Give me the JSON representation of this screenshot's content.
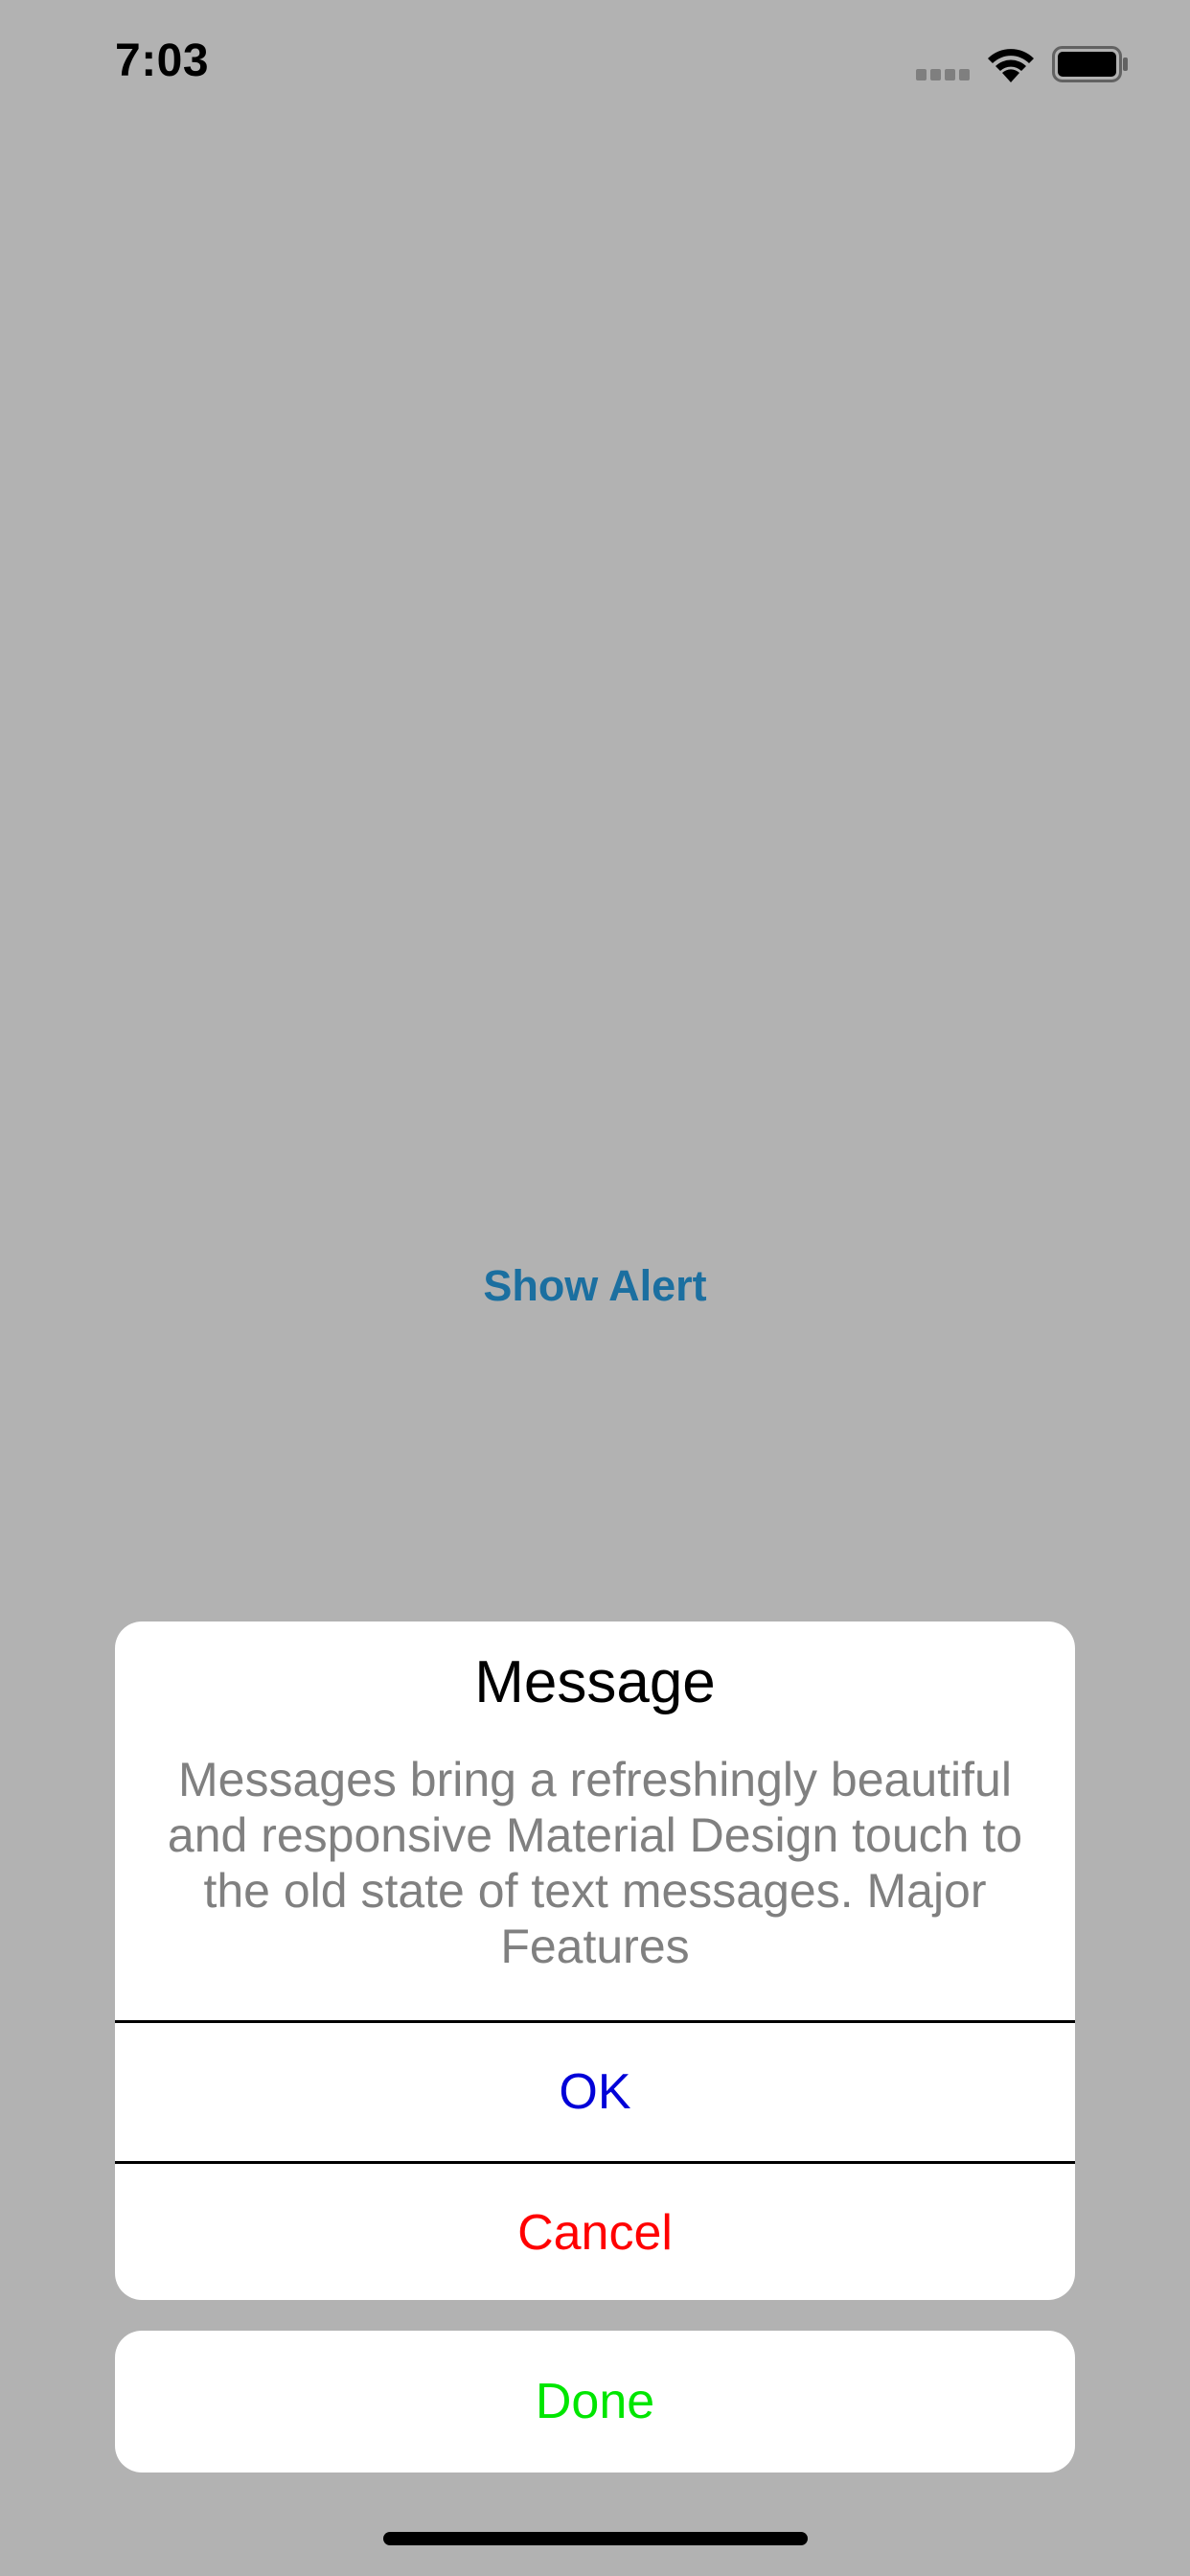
{
  "status_bar": {
    "time": "7:03",
    "icons": [
      "signal-icon",
      "wifi-icon",
      "battery-icon"
    ]
  },
  "main": {
    "show_alert_label": "Show Alert"
  },
  "alert": {
    "title": "Message",
    "message": "Messages bring a refreshingly beautiful and responsive Material Design touch to the old state of text messages. Major Features",
    "ok_label": "OK",
    "cancel_label": "Cancel"
  },
  "done_label": "Done",
  "colors": {
    "background": "#b2b2b2",
    "show_alert": "#1b6fa0",
    "ok": "#0000d8",
    "cancel": "#ff0000",
    "done": "#00e600",
    "message_text": "#808080"
  }
}
